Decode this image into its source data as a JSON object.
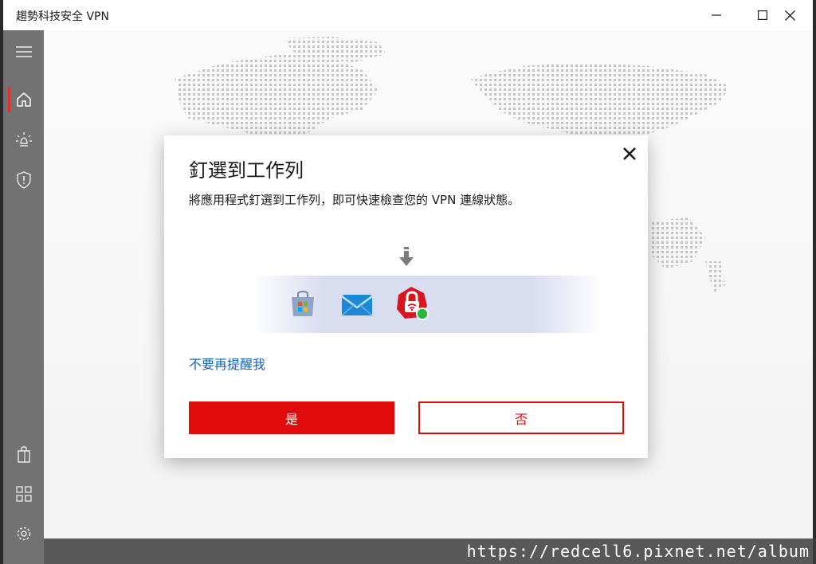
{
  "window": {
    "title": "趨勢科技安全 VPN",
    "controls": [
      "minimize-icon",
      "maximize-icon",
      "close-icon"
    ]
  },
  "sidebar": {
    "items": [
      {
        "icon": "hamburger-menu-icon",
        "active": false
      },
      {
        "icon": "home-icon",
        "active": true
      },
      {
        "icon": "lightbulb-icon",
        "active": false
      },
      {
        "icon": "shield-alert-icon",
        "active": false
      },
      {
        "icon": "shopping-bag-icon",
        "active": false
      },
      {
        "icon": "apps-grid-icon",
        "active": false
      },
      {
        "icon": "gear-icon",
        "active": false
      }
    ]
  },
  "dialog": {
    "title": "釘選到工作列",
    "description": "將應用程式釘選到工作列，即可快速檢查您的 VPN 連線狀態。",
    "illustration_icons": [
      "store-icon",
      "mail-icon",
      "trend-vpn-icon"
    ],
    "dismiss_link": "不要再提醒我",
    "yes_label": "是",
    "no_label": "否"
  },
  "colors": {
    "accent_red": "#e00b0b",
    "link_blue": "#1461b8",
    "sidebar_bg": "#5a5a5a"
  },
  "watermark": "https://redcell6.pixnet.net/album"
}
